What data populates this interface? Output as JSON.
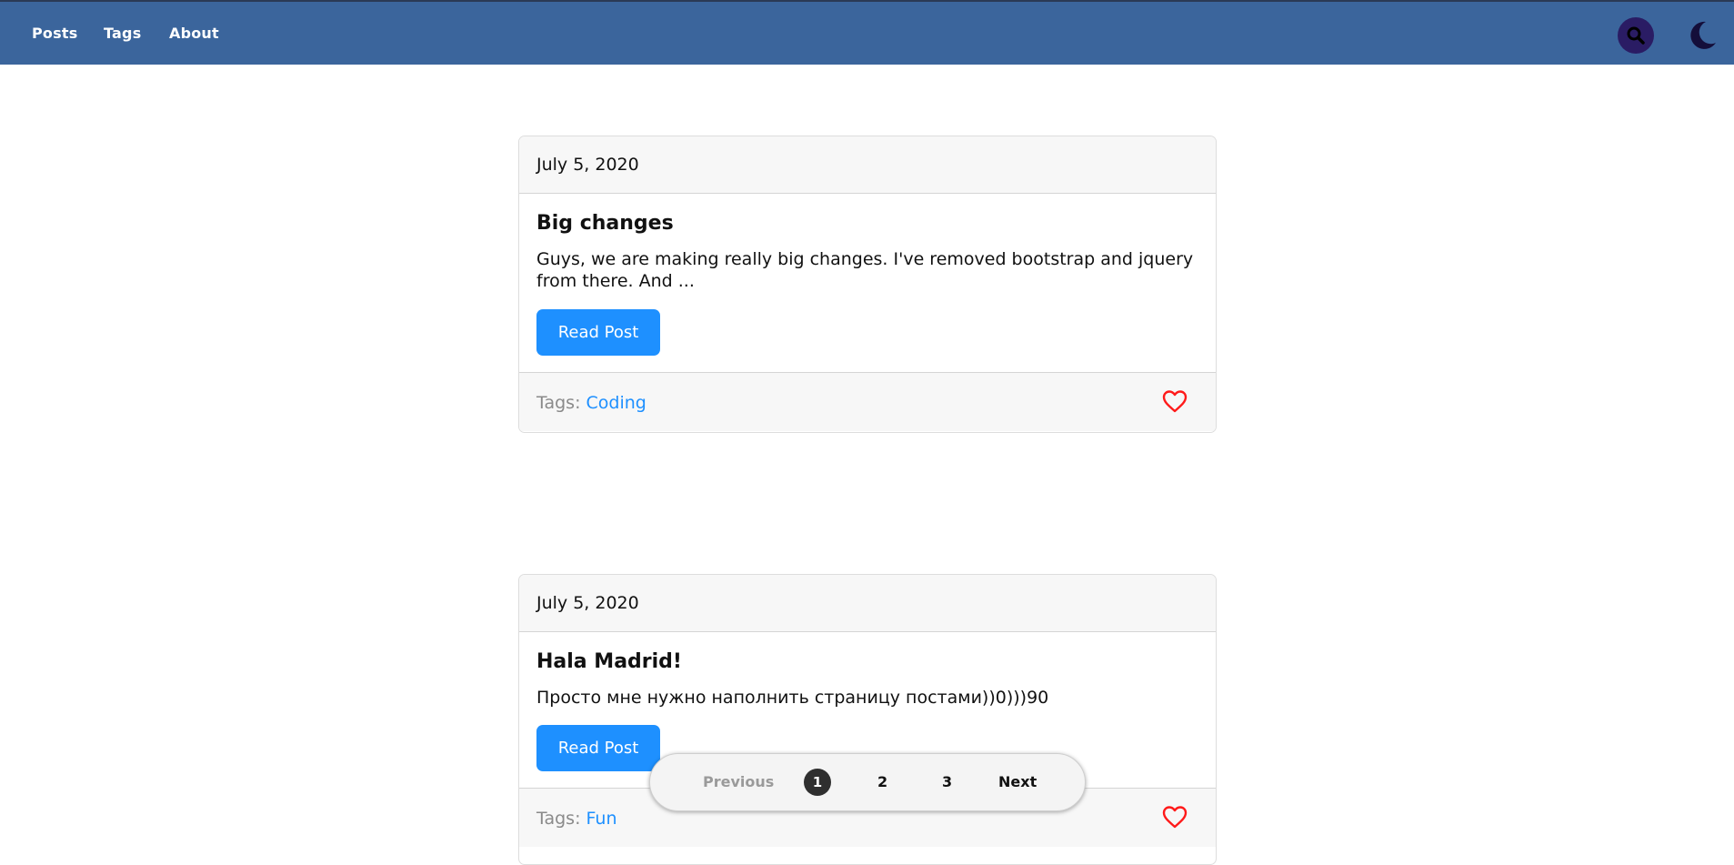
{
  "nav": {
    "links": [
      {
        "label": "Posts"
      },
      {
        "label": "Tags"
      },
      {
        "label": "About"
      }
    ],
    "search_icon": "search-icon",
    "theme_icon": "moon-icon"
  },
  "posts": [
    {
      "date": "July 5, 2020",
      "title": "Big changes",
      "excerpt": "Guys, we are making really big changes. I've removed bootstrap and jquery from there. And ...",
      "button_label": "Read Post",
      "tags_label": "Tags:",
      "tag": "Coding",
      "like_icon": "heart-icon"
    },
    {
      "date": "July 5, 2020",
      "title": "Hala Madrid!",
      "excerpt": "Просто мне нужно наполнить страницу постами))0)))90",
      "button_label": "Read Post",
      "tags_label": "Tags:",
      "tag": "Fun",
      "like_icon": "heart-icon"
    }
  ],
  "pagination": {
    "previous_label": "Previous",
    "pages": [
      "1",
      "2",
      "3"
    ],
    "current_page": "1",
    "next_label": "Next"
  },
  "colors": {
    "navbar": "#3b659c",
    "accent": "#1e90ff",
    "heart": "#ff1a1a",
    "search_button": "#2a1c64",
    "moon": "#140e3a"
  }
}
